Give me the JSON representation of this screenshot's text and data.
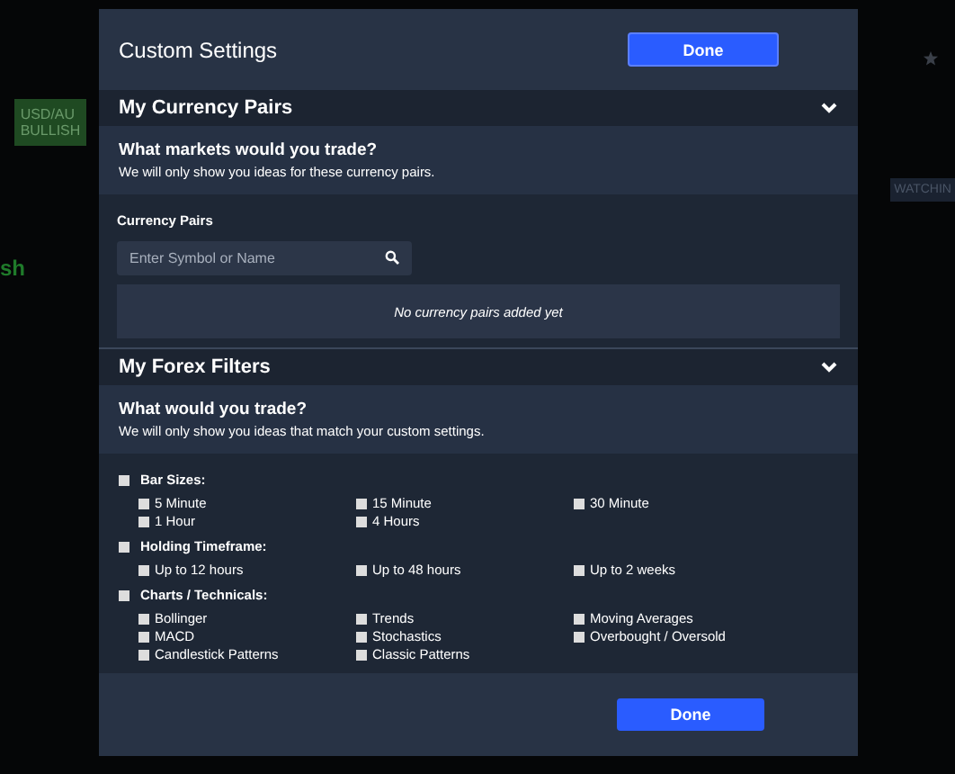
{
  "background": {
    "left_badge": "USD/AU",
    "left_badge_note": "BULLISH",
    "left_heading": "sh",
    "right_badge": "WATCHIN"
  },
  "dialog": {
    "title": "Custom Settings",
    "done_button": "Done",
    "currency_section": {
      "title": "My Currency Pairs",
      "expanded": true,
      "question": "What markets would you trade?",
      "note": "We will only show you ideas for these currency pairs.",
      "field_label": "Currency Pairs",
      "search": {
        "placeholder": "Enter Symbol or Name"
      },
      "empty_message": "No currency pairs added yet"
    },
    "filters_section": {
      "title": "My Forex Filters",
      "expanded": true,
      "question": "What would you trade?",
      "note": "We will only show you ideas that match your custom settings.",
      "groups": [
        {
          "label": "Bar Sizes:",
          "checked": false,
          "options": [
            {
              "label": "5 Minute",
              "checked": false
            },
            {
              "label": "15 Minute",
              "checked": false
            },
            {
              "label": "30 Minute",
              "checked": false
            },
            {
              "label": "1 Hour",
              "checked": false
            },
            {
              "label": "4 Hours",
              "checked": false
            }
          ]
        },
        {
          "label": "Holding Timeframe:",
          "checked": false,
          "options": [
            {
              "label": "Up to 12 hours",
              "checked": false
            },
            {
              "label": "Up to 48 hours",
              "checked": false
            },
            {
              "label": "Up to 2 weeks",
              "checked": false
            }
          ]
        },
        {
          "label": "Charts / Technicals:",
          "checked": false,
          "options": [
            {
              "label": "Bollinger",
              "checked": false
            },
            {
              "label": "Trends",
              "checked": false
            },
            {
              "label": "Moving Averages",
              "checked": false
            },
            {
              "label": "MACD",
              "checked": false
            },
            {
              "label": "Stochastics",
              "checked": false
            },
            {
              "label": "Overbought / Oversold",
              "checked": false
            },
            {
              "label": "Candlestick Patterns",
              "checked": false
            },
            {
              "label": "Classic Patterns",
              "checked": false
            }
          ]
        }
      ]
    },
    "footer_button": "Done"
  }
}
